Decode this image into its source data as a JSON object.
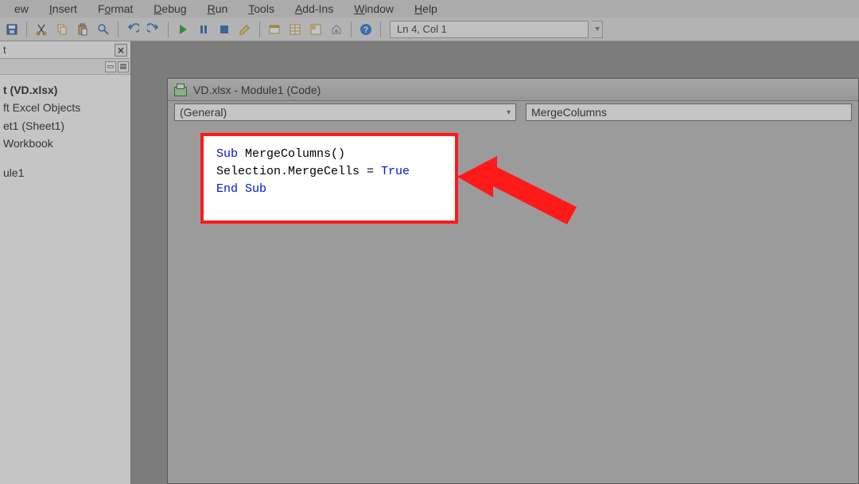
{
  "menu": {
    "items": [
      "ew",
      "Insert",
      "Format",
      "Debug",
      "Run",
      "Tools",
      "Add-Ins",
      "Window",
      "Help"
    ]
  },
  "toolbar": {
    "cursor_position": "Ln 4, Col 1"
  },
  "project_explorer": {
    "title": "t",
    "rows": [
      {
        "text": "t (VD.xlsx)",
        "bold": true
      },
      {
        "text": "ft Excel Objects",
        "bold": false
      },
      {
        "text": "et1 (Sheet1)",
        "bold": false
      },
      {
        "text": "Workbook",
        "bold": false
      },
      {
        "text": "",
        "bold": false
      },
      {
        "text": "ule1",
        "bold": false
      }
    ]
  },
  "code_window": {
    "title": "VD.xlsx - Module1 (Code)",
    "object_dropdown": "(General)",
    "procedure_dropdown": "MergeColumns"
  },
  "code": {
    "line1_kw": "Sub",
    "line1_name": " MergeColumns()",
    "line2_pre": "Selection.MergeCells = ",
    "line2_lit": "True",
    "line3_kw": "End Sub"
  }
}
